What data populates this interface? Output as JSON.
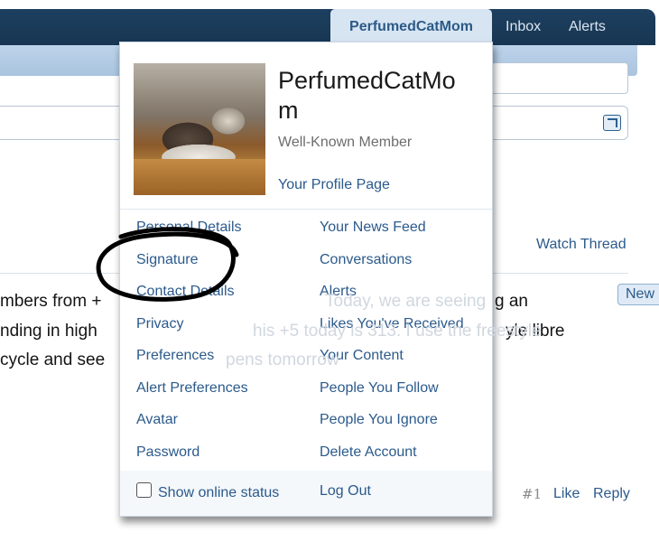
{
  "nav": {
    "account_tab": "PerfumedCatMom",
    "inbox": "Inbox",
    "alerts": "Alerts"
  },
  "thread": {
    "watch_thread": "Watch Thread",
    "new_badge": "New",
    "post_lines": [
      "mbers from +",
      "nding in high",
      " cycle and see"
    ],
    "post_lines_right": [
      "g an",
      "yle libre",
      ""
    ],
    "faded_text": [
      "Today, we are seeing",
      "his +5 today is 313. I use the freestyle",
      "pens tomorrow"
    ],
    "post_number": "#1",
    "like": "Like",
    "reply": "Reply"
  },
  "menu": {
    "username_line1": "PerfumedCatMo",
    "username_line2": "m",
    "member_title": "Well-Known Member",
    "profile_link": "Your Profile Page",
    "left_items": [
      "Personal Details",
      "Signature",
      "Contact Details",
      "Privacy",
      "Preferences",
      "Alert Preferences",
      "Avatar",
      "Password"
    ],
    "right_items": [
      "Your News Feed",
      "Conversations",
      "Alerts",
      "Likes You've Received",
      "Your Content",
      "People You Follow",
      "People You Ignore",
      "Delete Account"
    ],
    "show_online_status": "Show online status",
    "show_online_checked": false,
    "logout": "Log Out"
  },
  "icons": {
    "popout": "popout-icon",
    "checkbox": "checkbox-icon"
  },
  "colors": {
    "navbar": "#1d3f60",
    "link": "#2b5a8c",
    "active_tab_bg": "#d7e5f3"
  }
}
